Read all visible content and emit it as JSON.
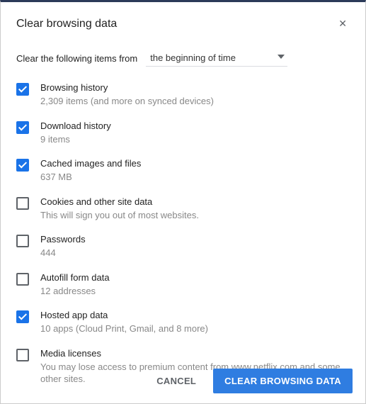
{
  "title": "Clear browsing data",
  "clear_label": "Clear the following items from",
  "time_range": "the beginning of time",
  "items": [
    {
      "title": "Browsing history",
      "sub": "2,309 items (and more on synced devices)",
      "checked": true
    },
    {
      "title": "Download history",
      "sub": "9 items",
      "checked": true
    },
    {
      "title": "Cached images and files",
      "sub": "637 MB",
      "checked": true
    },
    {
      "title": "Cookies and other site data",
      "sub": "This will sign you out of most websites.",
      "checked": false
    },
    {
      "title": "Passwords",
      "sub": "444",
      "checked": false
    },
    {
      "title": "Autofill form data",
      "sub": "12 addresses",
      "checked": false
    },
    {
      "title": "Hosted app data",
      "sub": "10 apps (Cloud Print, Gmail, and 8 more)",
      "checked": true
    },
    {
      "title": "Media licenses",
      "sub": "You may lose access to premium content from www.netflix.com and some other sites.",
      "checked": false
    }
  ],
  "buttons": {
    "cancel": "CANCEL",
    "clear": "CLEAR BROWSING DATA"
  }
}
